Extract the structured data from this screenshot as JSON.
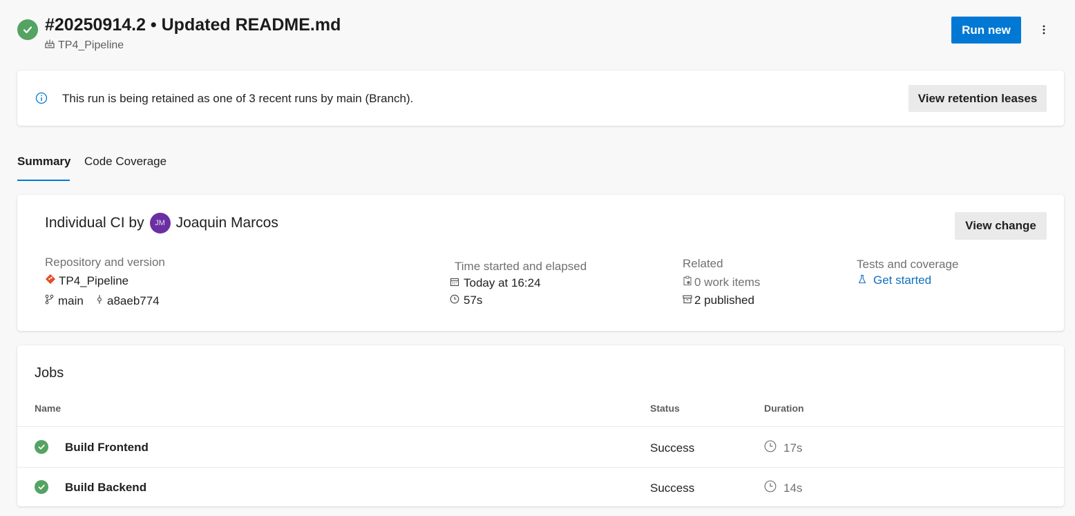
{
  "header": {
    "title": "#20250914.2 • Updated README.md",
    "pipeline_name": "TP4_Pipeline",
    "run_new_label": "Run new"
  },
  "banner": {
    "message": "This run is being retained as one of 3 recent runs by main (Branch).",
    "button_label": "View retention leases"
  },
  "tabs": [
    {
      "label": "Summary",
      "active": true
    },
    {
      "label": "Code Coverage",
      "active": false
    }
  ],
  "summary": {
    "trigger_prefix": "Individual CI by",
    "user_initials": "JM",
    "user_name": "Joaquin Marcos",
    "view_change_label": "View change",
    "repository": {
      "label": "Repository and version",
      "repo_name": "TP4_Pipeline",
      "branch": "main",
      "commit": "a8aeb774"
    },
    "time": {
      "label": "Time started and elapsed",
      "started": "Today at 16:24",
      "elapsed": "57s"
    },
    "related": {
      "label": "Related",
      "work_items": "0 work items",
      "published": "2 published"
    },
    "tests": {
      "label": "Tests and coverage",
      "link": "Get started"
    }
  },
  "jobs": {
    "title": "Jobs",
    "columns": {
      "name": "Name",
      "status": "Status",
      "duration": "Duration"
    },
    "rows": [
      {
        "name": "Build Frontend",
        "status": "Success",
        "duration": "17s"
      },
      {
        "name": "Build Backend",
        "status": "Success",
        "duration": "14s"
      }
    ]
  },
  "colors": {
    "accent": "#0078d4",
    "success": "#55a362",
    "avatar": "#6b2fa3",
    "git_icon": "#e44d26"
  }
}
